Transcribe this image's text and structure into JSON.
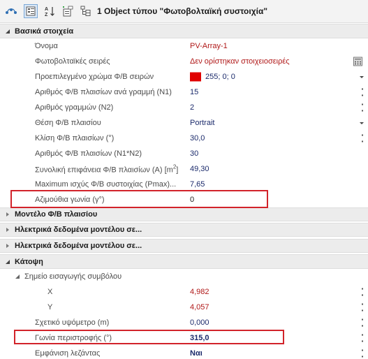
{
  "toolbar": {
    "title": "1 Object  τύπου \"Φωτοβολταϊκή συστοιχία\"",
    "buttons": [
      "connect-icon",
      "categorized-icon",
      "sort-az-icon",
      "add-object-icon",
      "tree-icon"
    ]
  },
  "categories": {
    "basic": "Βασικά στοιχεία",
    "model": "Μοντέλο Φ/Β πλαισίου",
    "elec1": "Ηλεκτρικά δεδομένα μοντέλου σε...",
    "elec2": "Ηλεκτρικά δεδομένα μοντέλου σε...",
    "plan": "Κάτοψη"
  },
  "props": {
    "name": {
      "label": "Όνομα",
      "value": "PV-Array-1"
    },
    "strings": {
      "label": "Φωτοβολταϊκές σειρές",
      "value": "Δεν ορίστηκαν στοιχειοσειρές"
    },
    "color": {
      "label": "Προεπιλεγμένο χρώμα Φ/Β σειρών",
      "value": "255; 0; 0",
      "swatch": "#e00000"
    },
    "n1": {
      "label": "Αριθμός Φ/Β πλαισίων ανά γραμμή (N1)",
      "value": "15"
    },
    "n2": {
      "label": "Αριθμός γραμμών (N2)",
      "value": "2"
    },
    "position": {
      "label": "Θέση Φ/Β πλαισίου",
      "value": "Portrait"
    },
    "tilt": {
      "label": "Κλίση Φ/Β πλαισίων (°)",
      "value": "30,0"
    },
    "count": {
      "label": "Αριθμός Φ/Β πλαισίων (N1*N2)",
      "value": "30"
    },
    "area": {
      "label": "Συνολική επιφάνεια Φ/Β πλαισίων (A) [m",
      "sup": "2",
      "tail": "]",
      "value": "49,30"
    },
    "pmax": {
      "label": "Maximum ισχύς Φ/Β συστοιχίας (Pmax)...",
      "value": "7,65"
    },
    "azimuth": {
      "label": "Αζιμούθια γωνία (γ°)",
      "value": "0"
    },
    "insert_point": {
      "label": "Σημείο εισαγωγής συμβόλου"
    },
    "x": {
      "label": "X",
      "value": "4,982"
    },
    "y": {
      "label": "Y",
      "value": "4,057"
    },
    "elevation": {
      "label": "Σχετικό υψόμετρο (m)",
      "value": "0,000"
    },
    "rotation": {
      "label": "Γωνία περιστροφής (°)",
      "value": "315,0"
    },
    "legend": {
      "label": "Εμφάνιση λεζάντας",
      "value": "Ναι"
    }
  },
  "colors": {
    "value_navy": "#1b2a6b",
    "value_red": "#b01818",
    "highlight": "#d2232a",
    "category_bg": "#ececec"
  }
}
